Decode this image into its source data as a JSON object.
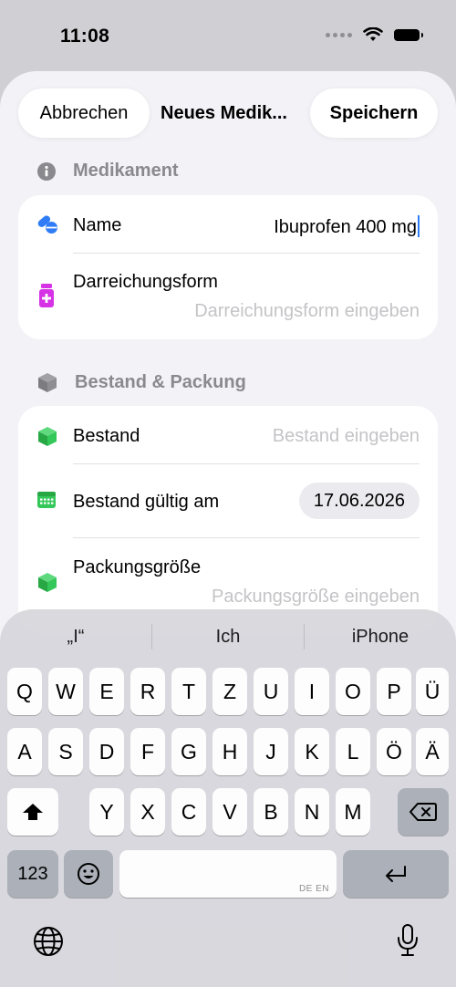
{
  "status_bar": {
    "time": "11:08"
  },
  "nav": {
    "cancel_label": "Abbrechen",
    "title": "Neues Medik...",
    "save_label": "Speichern"
  },
  "sections": {
    "medication": {
      "header": "Medikament",
      "name_label": "Name",
      "name_value": "Ibuprofen 400 mg",
      "dosage_form_label": "Darreichungsform",
      "dosage_form_placeholder": "Darreichungsform eingeben"
    },
    "stock": {
      "header": "Bestand & Packung",
      "stock_label": "Bestand",
      "stock_placeholder": "Bestand eingeben",
      "valid_label": "Bestand gültig am",
      "valid_date": "17.06.2026",
      "pack_size_label": "Packungsgröße",
      "pack_size_placeholder": "Packungsgröße eingeben"
    }
  },
  "keyboard": {
    "suggestions": [
      "„I“",
      "Ich",
      "iPhone"
    ],
    "row1": [
      "Q",
      "W",
      "E",
      "R",
      "T",
      "Z",
      "U",
      "I",
      "O",
      "P",
      "Ü"
    ],
    "row2": [
      "A",
      "S",
      "D",
      "F",
      "G",
      "H",
      "J",
      "K",
      "L",
      "Ö",
      "Ä"
    ],
    "row3": [
      "Y",
      "X",
      "C",
      "V",
      "B",
      "N",
      "M"
    ],
    "numbers_label": "123",
    "space_hint": "DE EN"
  },
  "colors": {
    "accent_blue": "#2f7cf6",
    "form_icon_magenta": "#d633e6",
    "stock_icon_green": "#34c759"
  },
  "icons": {
    "medication_header": "info-circle-icon",
    "name": "pills-icon",
    "dosage_form": "medicine-bottle-icon",
    "stock_header": "box-icon",
    "stock": "box-icon",
    "valid_date": "calendar-icon",
    "pack_size": "box-icon",
    "shift": "shift-icon",
    "delete": "delete-icon",
    "emoji": "emoji-icon",
    "return": "return-icon",
    "globe": "globe-icon",
    "mic": "microphone-icon"
  }
}
